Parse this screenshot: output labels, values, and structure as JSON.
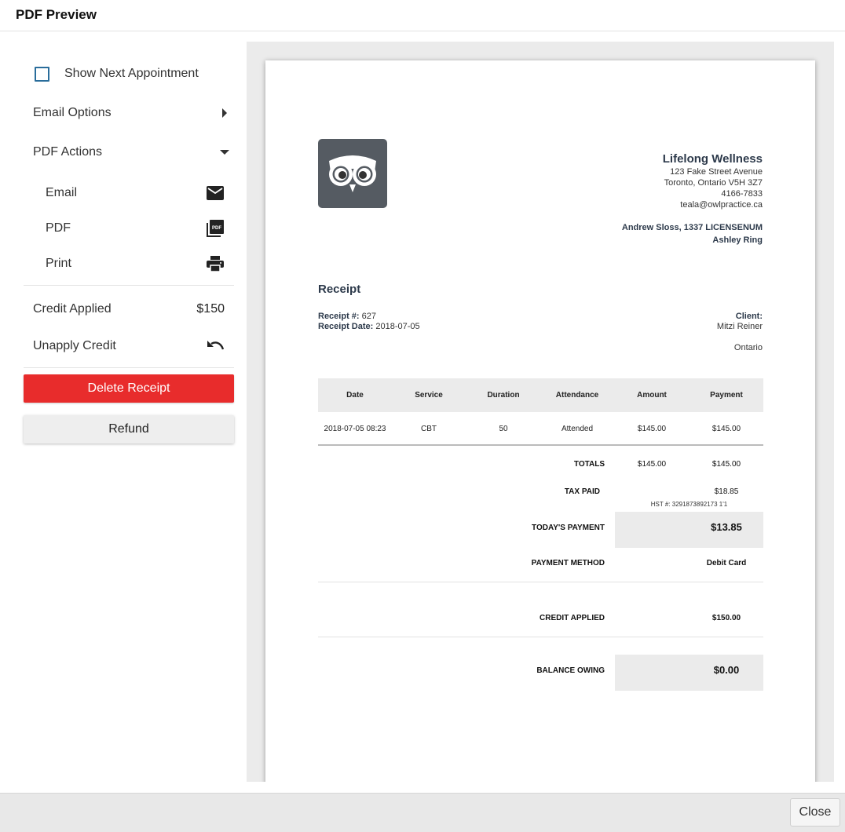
{
  "header": {
    "title": "PDF Preview"
  },
  "sidebar": {
    "show_next_appointment": "Show Next Appointment",
    "email_options": "Email Options",
    "pdf_actions": "PDF Actions",
    "actions": [
      {
        "label": "Email",
        "icon": "email-icon"
      },
      {
        "label": "PDF",
        "icon": "pdf-icon"
      },
      {
        "label": "Print",
        "icon": "print-icon"
      }
    ],
    "credit_applied_label": "Credit Applied",
    "credit_applied_value": "$150",
    "unapply_credit": "Unapply Credit",
    "delete_receipt": "Delete Receipt",
    "refund": "Refund"
  },
  "receipt": {
    "clinic": {
      "name": "Lifelong Wellness",
      "street": "123 Fake Street Avenue",
      "city": "Toronto, Ontario  V5H 3Z7",
      "phone": "4166-7833",
      "email": "teala@owlpractice.ca"
    },
    "provider_line1": "Andrew Sloss, 1337 LICENSENUM",
    "provider_line2": "Ashley Ring",
    "title": "Receipt",
    "number_label": "Receipt #:",
    "number": "627",
    "date_label": "Receipt Date:",
    "date": "2018-07-05",
    "client_label": "Client:",
    "client_name": "Mitzi Reiner",
    "client_province": "Ontario",
    "table": {
      "headers": [
        "Date",
        "Service",
        "Duration",
        "Attendance",
        "Amount",
        "Payment"
      ],
      "rows": [
        [
          "2018-07-05 08:23",
          "CBT",
          "50",
          "Attended",
          "$145.00",
          "$145.00"
        ]
      ]
    },
    "totals_label": "TOTALS",
    "totals_amount": "$145.00",
    "totals_payment": "$145.00",
    "tax_label": "TAX PAID",
    "tax_value": "$18.85",
    "hst": "HST #: 3291873892173 1'1",
    "todays_payment_label": "TODAY'S PAYMENT",
    "todays_payment_value": "$13.85",
    "payment_method_label": "PAYMENT METHOD",
    "payment_method_value": "Debit Card",
    "credit_applied_label": "CREDIT APPLIED",
    "credit_applied_value": "$150.00",
    "balance_label": "BALANCE OWING",
    "balance_value": "$0.00"
  },
  "footer": {
    "close": "Close"
  },
  "colors": {
    "danger": "#e82c2c",
    "checkbox": "#2a6d9b",
    "logo_bg": "#555b62",
    "heading": "#2d3a4b"
  }
}
